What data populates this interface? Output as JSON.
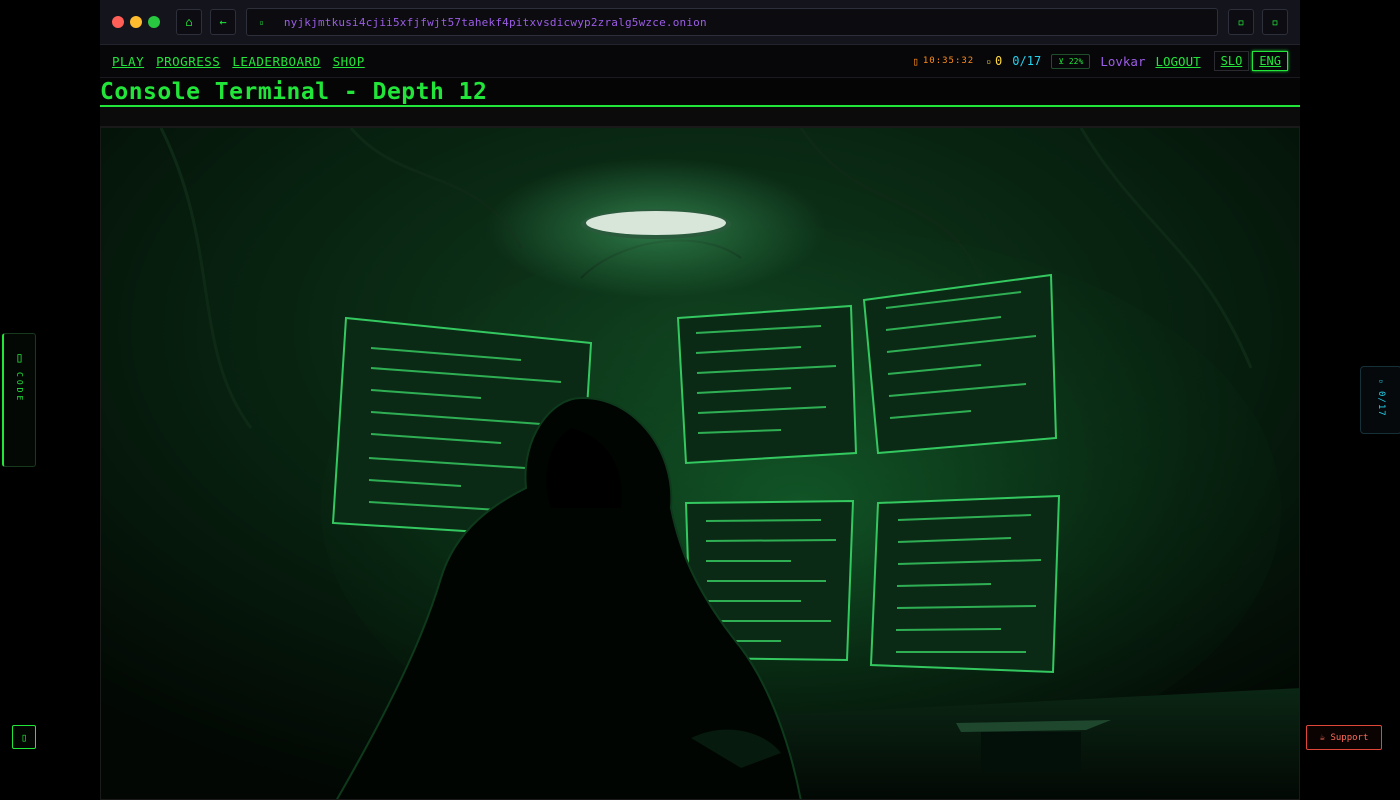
{
  "browser": {
    "url": "nyjkjmtkusi4cjii5xfjfwjt57tahekf4pitxvsdicwyp2zralg5wzce.onion",
    "home_icon": "⌂",
    "back_icon": "←",
    "lock_icon": "▫",
    "action1_icon": "▫",
    "action2_icon": "▫"
  },
  "nav": {
    "links": [
      "PLAY",
      "PROGRESS",
      "LEADERBOARD",
      "SHOP"
    ],
    "clock_icon": "▯",
    "clock": "10:35:32",
    "coin_icon": "▫",
    "coins": "0",
    "progress": "0/17",
    "percent": "⊻ 22%",
    "username": "Lovkar",
    "logout": "LOGOUT",
    "languages": [
      "SLO",
      "ENG"
    ],
    "active_language": "ENG"
  },
  "page": {
    "title": "Console Terminal - Depth 12"
  },
  "side": {
    "code_icon": "▯",
    "code_label": "CODE",
    "progress_icon": "▫",
    "progress_label": "0/17",
    "corner_icon": "▯",
    "support_label": "☕ Support"
  },
  "colors": {
    "terminal_green": "#22e53a",
    "purple": "#9b5de5",
    "cyan": "#22d3ee",
    "orange": "#ff8c1a",
    "yellow": "#ffd93d",
    "support_red": "#e0463a"
  }
}
